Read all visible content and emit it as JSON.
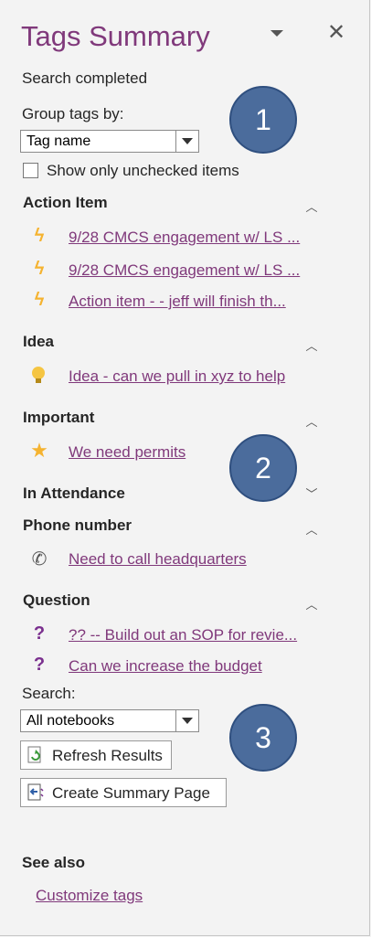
{
  "panel": {
    "title": "Tags Summary",
    "status": "Search completed",
    "group_by_label": "Group tags by:",
    "group_by_value": "Tag name",
    "show_unchecked_label": "Show only unchecked items"
  },
  "groups": [
    {
      "name": "Action Item",
      "chevron": "up",
      "items": [
        {
          "icon": "lightning-icon",
          "text": "9/28 CMCS engagement w/ LS ..."
        },
        {
          "icon": "lightning-icon",
          "text": "9/28 CMCS engagement w/ LS ..."
        },
        {
          "icon": "lightning-icon",
          "text": "Action item - - jeff will finish th..."
        }
      ]
    },
    {
      "name": "Idea",
      "chevron": "up",
      "items": [
        {
          "icon": "lightbulb-icon",
          "text": "Idea - can we pull in xyz to help"
        }
      ]
    },
    {
      "name": "Important",
      "chevron": "up",
      "items": [
        {
          "icon": "star-icon",
          "text": "We need permits"
        }
      ]
    },
    {
      "name": "In Attendance",
      "chevron": "down",
      "items": []
    },
    {
      "name": "Phone number",
      "chevron": "up",
      "items": [
        {
          "icon": "phone-icon",
          "text": "Need to call headquarters"
        }
      ]
    },
    {
      "name": "Question",
      "chevron": "up",
      "items": [
        {
          "icon": "question-icon",
          "text": "?? -- Build out an SOP for revie..."
        },
        {
          "icon": "question-icon",
          "text": "Can we increase the budget"
        }
      ]
    }
  ],
  "search": {
    "label": "Search:",
    "value": "All notebooks",
    "refresh_label": "Refresh Results",
    "create_label": "Create Summary Page"
  },
  "see_also": {
    "heading": "See also",
    "customize_link": "Customize tags"
  },
  "callouts": [
    "1",
    "2",
    "3"
  ],
  "colors": {
    "accent": "#80397b",
    "callout": "#4b6c9c",
    "icon_yellow": "#f5b330"
  }
}
